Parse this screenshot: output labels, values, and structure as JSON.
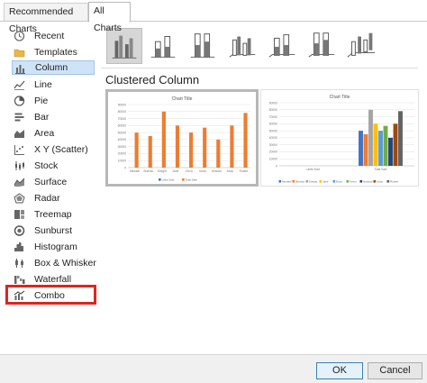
{
  "tabs": {
    "recommended": "Recommended Charts",
    "all": "All Charts"
  },
  "sidebar": {
    "items": [
      {
        "label": "Recent",
        "icon": "clock-icon"
      },
      {
        "label": "Templates",
        "icon": "folder-icon"
      },
      {
        "label": "Column",
        "icon": "column-chart-icon",
        "selected": true
      },
      {
        "label": "Line",
        "icon": "line-chart-icon"
      },
      {
        "label": "Pie",
        "icon": "pie-chart-icon"
      },
      {
        "label": "Bar",
        "icon": "bar-chart-icon"
      },
      {
        "label": "Area",
        "icon": "area-chart-icon"
      },
      {
        "label": "X Y (Scatter)",
        "icon": "scatter-chart-icon"
      },
      {
        "label": "Stock",
        "icon": "stock-chart-icon"
      },
      {
        "label": "Surface",
        "icon": "surface-chart-icon"
      },
      {
        "label": "Radar",
        "icon": "radar-chart-icon"
      },
      {
        "label": "Treemap",
        "icon": "treemap-chart-icon"
      },
      {
        "label": "Sunburst",
        "icon": "sunburst-chart-icon"
      },
      {
        "label": "Histogram",
        "icon": "histogram-chart-icon"
      },
      {
        "label": "Box & Whisker",
        "icon": "box-whisker-chart-icon"
      },
      {
        "label": "Waterfall",
        "icon": "waterfall-chart-icon"
      },
      {
        "label": "Combo",
        "icon": "combo-chart-icon",
        "highlighted": true
      }
    ]
  },
  "main": {
    "variant_title": "Clustered Column",
    "subtype_icons": [
      "clustered-column-icon",
      "stacked-column-icon",
      "100-stacked-column-icon",
      "3d-clustered-column-icon",
      "3d-stacked-column-icon",
      "3d-100-stacked-column-icon",
      "3d-column-icon"
    ],
    "selected_subtype": 0,
    "preview_1": {
      "title": "Chart Title",
      "y_ticks": [
        "90000",
        "80000",
        "70000",
        "60000",
        "50000",
        "40000",
        "30000",
        "20000",
        "10000",
        "0"
      ],
      "categories": [
        "Michael",
        "Brenda",
        "Dwight",
        "Jane",
        "Erica",
        "Kevin",
        "Howard",
        "Andy",
        "Robert"
      ],
      "legend": [
        "Units Sold",
        "Total Sale"
      ]
    },
    "preview_2": {
      "title": "Chart Title",
      "y_ticks": [
        "90000",
        "80000",
        "70000",
        "60000",
        "50000",
        "40000",
        "30000",
        "20000",
        "10000",
        "0"
      ],
      "categories": [
        "Units Sold",
        "Total Sale"
      ],
      "legend": [
        "Michael",
        "Brenda",
        "Dwight",
        "Jane",
        "Erica",
        "Kevin",
        "Howard",
        "Andy",
        "Robert"
      ]
    }
  },
  "chart_data": [
    {
      "type": "bar",
      "title": "Chart Title",
      "categories": [
        "Michael",
        "Brenda",
        "Dwight",
        "Jane",
        "Erica",
        "Kevin",
        "Howard",
        "Andy",
        "Robert"
      ],
      "series": [
        {
          "name": "Units Sold",
          "values": [
            0,
            0,
            0,
            0,
            0,
            0,
            0,
            0,
            0
          ]
        },
        {
          "name": "Total Sale",
          "values": [
            50000,
            45000,
            80000,
            60000,
            50000,
            57000,
            40000,
            60000,
            78000
          ]
        }
      ],
      "ylim": [
        0,
        90000
      ]
    },
    {
      "type": "bar",
      "title": "Chart Title",
      "categories": [
        "Units Sold",
        "Total Sale"
      ],
      "series": [
        {
          "name": "Michael",
          "values": [
            0,
            50000
          ]
        },
        {
          "name": "Brenda",
          "values": [
            0,
            45000
          ]
        },
        {
          "name": "Dwight",
          "values": [
            0,
            80000
          ]
        },
        {
          "name": "Jane",
          "values": [
            0,
            60000
          ]
        },
        {
          "name": "Erica",
          "values": [
            0,
            50000
          ]
        },
        {
          "name": "Kevin",
          "values": [
            0,
            57000
          ]
        },
        {
          "name": "Howard",
          "values": [
            0,
            40000
          ]
        },
        {
          "name": "Andy",
          "values": [
            0,
            60000
          ]
        },
        {
          "name": "Robert",
          "values": [
            0,
            78000
          ]
        }
      ],
      "ylim": [
        0,
        90000
      ]
    }
  ],
  "colors": {
    "orange": "#ed7d31",
    "blue": "#4472c4",
    "accent_highlight": "#e0241f",
    "selected_bg": "#cfe3f6",
    "series2_palette": [
      "#4472c4",
      "#ed7d31",
      "#a5a5a5",
      "#ffc000",
      "#5b9bd5",
      "#70ad47",
      "#264478",
      "#9e480e",
      "#636363"
    ]
  },
  "buttons": {
    "ok": "OK",
    "cancel": "Cancel"
  }
}
